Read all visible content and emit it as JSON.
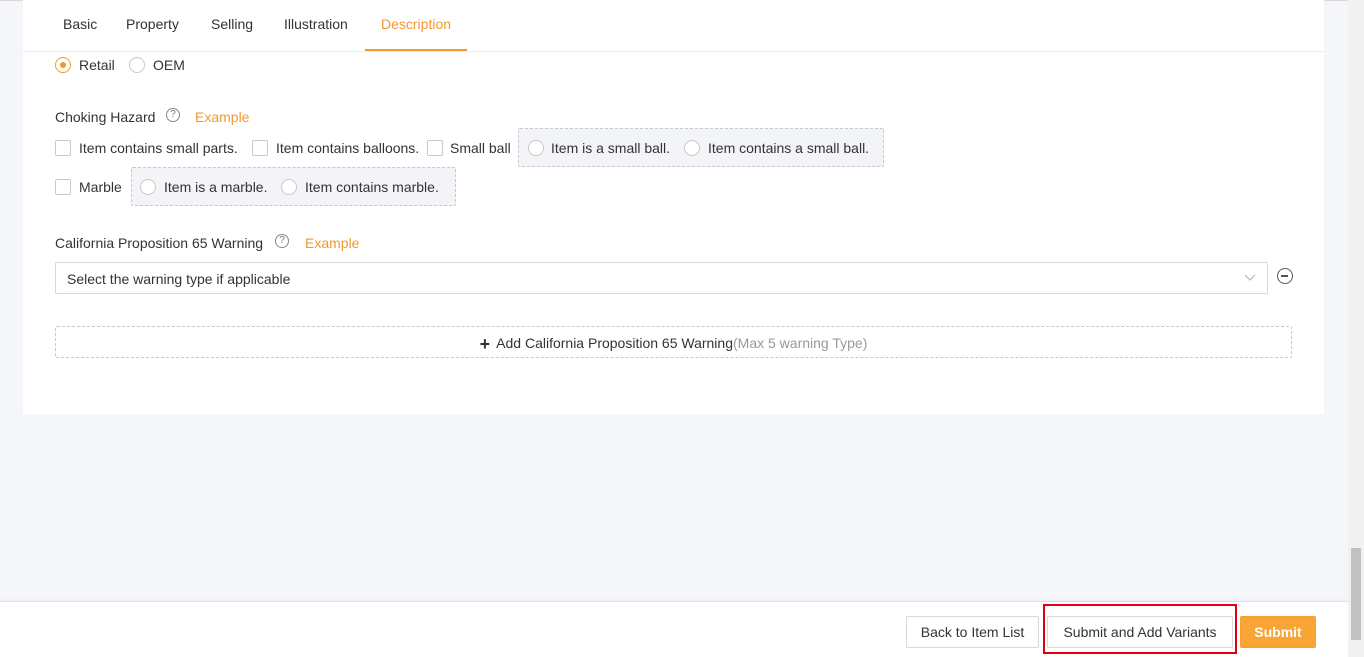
{
  "tabs": [
    {
      "label": "Basic"
    },
    {
      "label": "Property"
    },
    {
      "label": "Selling"
    },
    {
      "label": "Illustration"
    },
    {
      "label": "Description",
      "active": true
    }
  ],
  "sales_type": {
    "options": [
      "Retail",
      "OEM"
    ],
    "selected": "Retail"
  },
  "choking_hazard": {
    "label": "Choking Hazard",
    "example": "Example",
    "checkboxes": [
      "Item contains small parts.",
      "Item contains balloons.",
      "Small ball",
      "Marble"
    ],
    "small_ball_options": [
      "Item is a small ball.",
      "Item contains a small ball."
    ],
    "marble_options": [
      "Item is a marble.",
      "Item contains marble."
    ]
  },
  "prop65": {
    "label": "California Proposition 65 Warning",
    "example": "Example",
    "select_placeholder": "Select the warning type if applicable",
    "add_label": "Add California Proposition 65 Warning",
    "add_note": "(Max 5 warning Type)"
  },
  "footer": {
    "back_label": "Back to Item List",
    "submit_variants_label": "Submit and Add Variants",
    "submit_label": "Submit"
  },
  "colors": {
    "accent": "#f2992e",
    "highlight": "#e0000f"
  }
}
